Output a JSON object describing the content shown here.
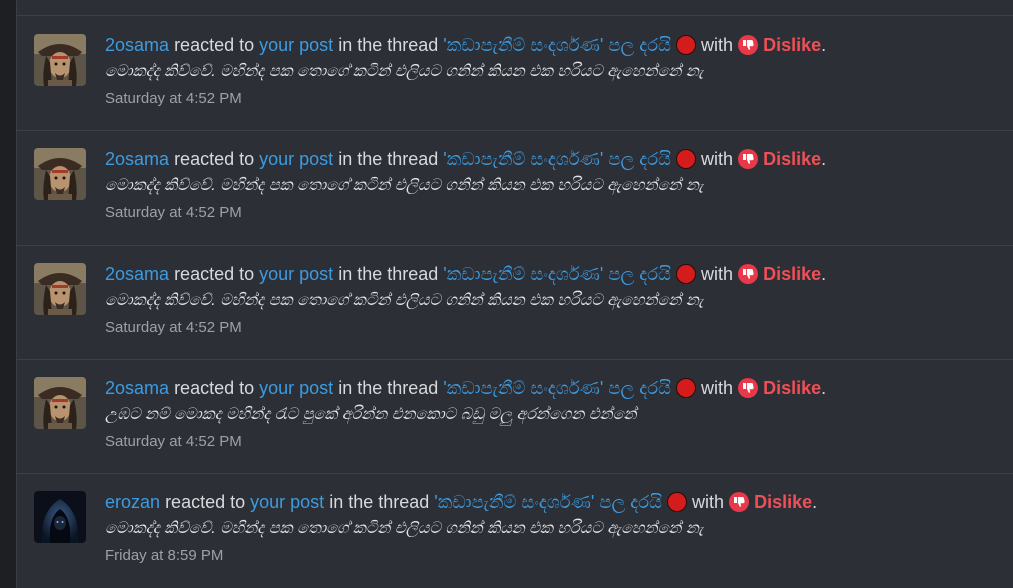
{
  "alerts": [
    {
      "user": "2osama",
      "reacted_to": "reacted to",
      "your_post": "your post",
      "in_the_thread": "in the thread",
      "thread": "'කඩාපැනීම් සංදර්ශණ' පල දරයි",
      "with": "with",
      "reaction": "Dislike",
      "period": ".",
      "snippet": "මොකද්ද කිව්වේ. මහින්ද පක තොගේ කටින් එලියට ගනින් කියන එක හරියට ඇහෙන්නේ නැ",
      "time": "Saturday at 4:52 PM",
      "avatar": "pirate"
    },
    {
      "user": "2osama",
      "reacted_to": "reacted to",
      "your_post": "your post",
      "in_the_thread": "in the thread",
      "thread": "'කඩාපැනීම් සංදර්ශණ' පල දරයි",
      "with": "with",
      "reaction": "Dislike",
      "period": ".",
      "snippet": "මොකද්ද කිව්වේ. මහින්ද පක තොගේ කටින් එලියට ගනින් කියන එක හරියට ඇහෙන්නේ නැ",
      "time": "Saturday at 4:52 PM",
      "avatar": "pirate"
    },
    {
      "user": "2osama",
      "reacted_to": "reacted to",
      "your_post": "your post",
      "in_the_thread": "in the thread",
      "thread": "'කඩාපැනීම් සංදර්ශණ' පල දරයි",
      "with": "with",
      "reaction": "Dislike",
      "period": ".",
      "snippet": "මොකද්ද කිව්වේ. මහින්ද පක තොගේ කටින් එලියට ගනින් කියන එක හරියට ඇහෙන්නේ නැ",
      "time": "Saturday at 4:52 PM",
      "avatar": "pirate"
    },
    {
      "user": "2osama",
      "reacted_to": "reacted to",
      "your_post": "your post",
      "in_the_thread": "in the thread",
      "thread": "'කඩාපැනීම් සංදර්ශණ' පල දරයි",
      "with": "with",
      "reaction": "Dislike",
      "period": ".",
      "snippet": "උඹට නම් මොකද මහින්ද රැට පුකේ අරින්න එනකොට බඩු මලු අරන්ගෙන එන්නේ",
      "time": "Saturday at 4:52 PM",
      "avatar": "pirate"
    },
    {
      "user": "erozan",
      "reacted_to": "reacted to",
      "your_post": "your post",
      "in_the_thread": "in the thread",
      "thread": "'කඩාපැනීම් සංදර්ශණ' පල දරයි",
      "with": "with",
      "reaction": "Dislike",
      "period": ".",
      "snippet": "මොකද්ද කිව්වේ. මහින්ද පක තොගේ කටින් එලියට ගනින් කියන එක හරියට ඇහෙන්නේ නැ",
      "time": "Friday at 8:59 PM",
      "avatar": "hooded"
    }
  ],
  "icons": {
    "red_circle": "red-circle-icon",
    "dislike": "thumbs-down-icon"
  },
  "colors": {
    "link": "#3d9be0",
    "dislike": "#ef4f56",
    "background": "#2c2f36"
  }
}
